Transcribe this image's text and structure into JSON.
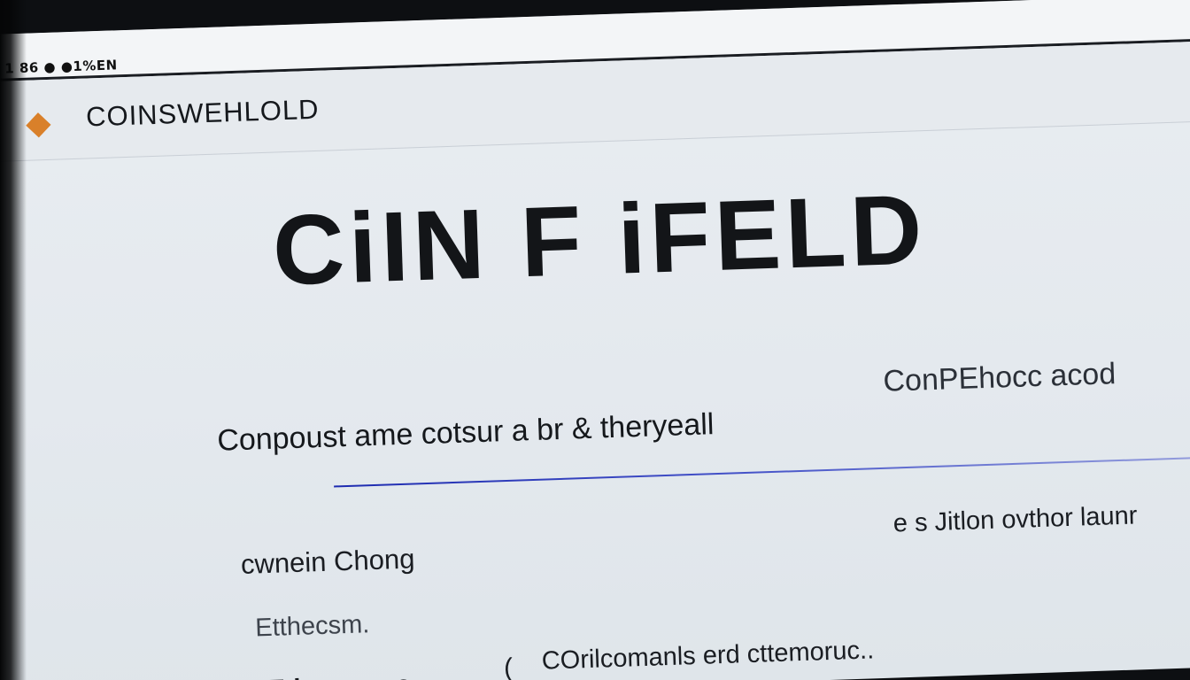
{
  "status_bar": {
    "text": "1 86 ● ●1%EN"
  },
  "header": {
    "brand_icon": "diamond-logo-icon",
    "brand_color": "#d9802a",
    "brand_name": "COINSWEHLOLD"
  },
  "hero": {
    "title": "CiIN F iFELD"
  },
  "tagline": {
    "left": "Conpoust ame cotsur a br & theryeall",
    "right": "ConPEhocc acod"
  },
  "accent_color": "#1d2bb0",
  "author": {
    "name": "cwnein Chong",
    "role": "e s Jitlon ovthor launr"
  },
  "meta": {
    "text": "Etthecsm."
  },
  "footer": {
    "left": "Etherroy us .",
    "right_mark": "(",
    "right": "COrilcomanls erd cttemoruc.."
  }
}
